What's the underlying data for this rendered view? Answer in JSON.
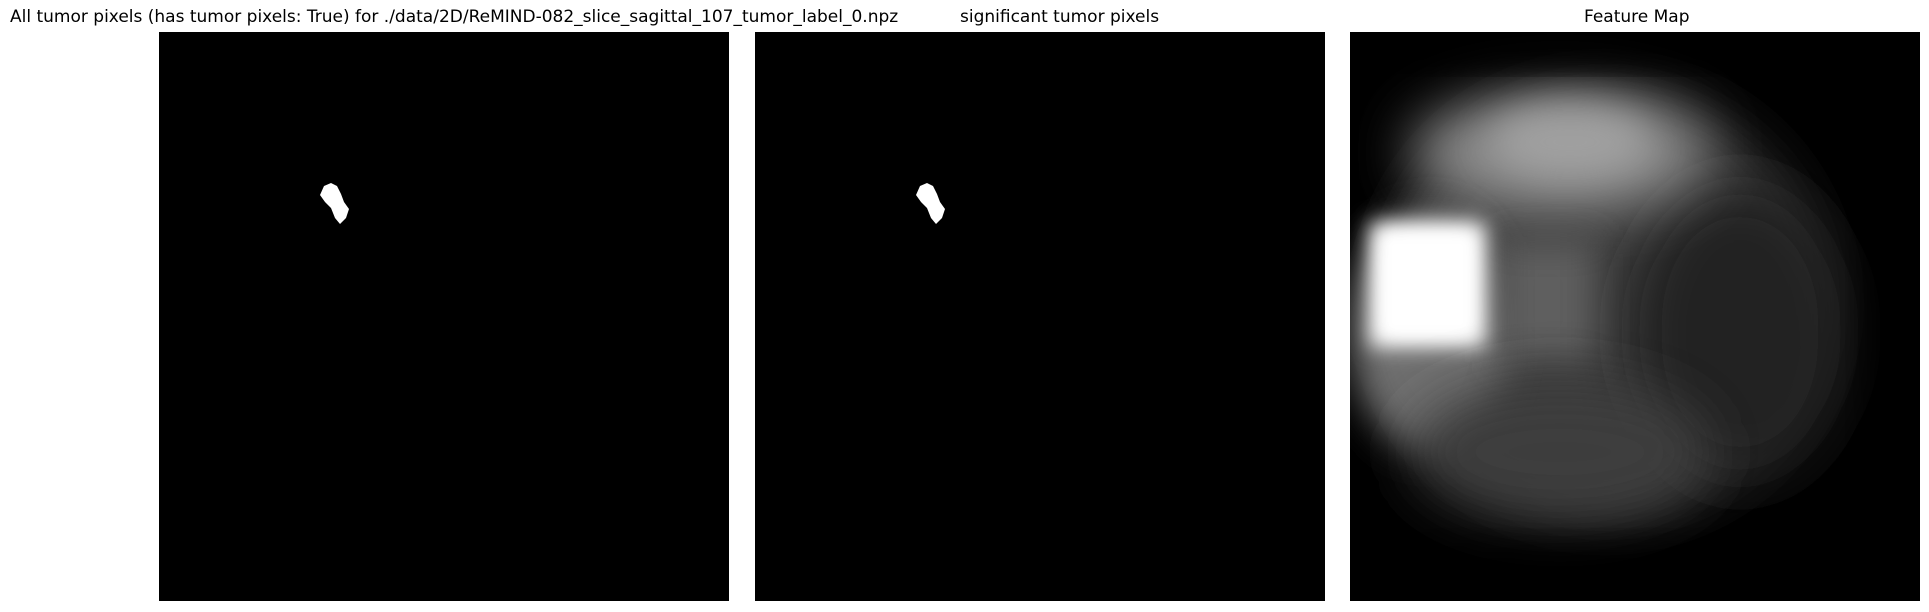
{
  "figure": {
    "panels": [
      {
        "title": "All tumor pixels (has tumor pixels: True) for ./data/2D/ReMIND-082_slice_sagittal_107_tumor_label_0.npz",
        "content": "binary tumor mask"
      },
      {
        "title": "significant tumor pixels",
        "content": "binary significant tumor mask"
      },
      {
        "title": "Feature Map",
        "content": "blurred grayscale feature map"
      }
    ],
    "colors": {
      "background": "#000000",
      "mask": "#ffffff",
      "page": "#ffffff"
    }
  }
}
